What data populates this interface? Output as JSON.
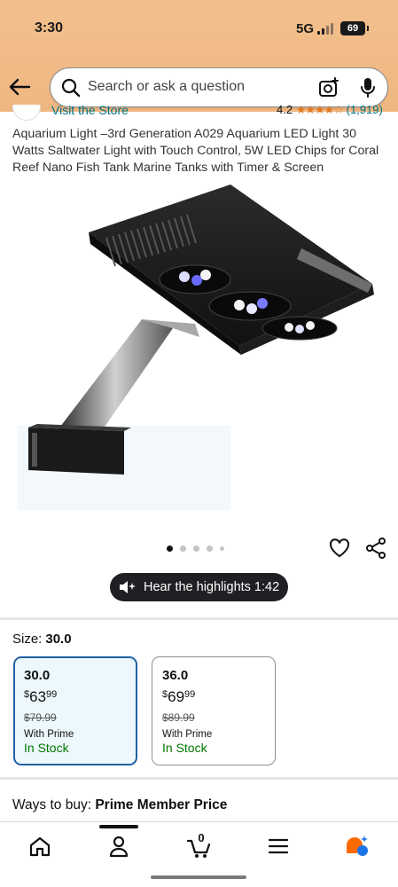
{
  "status_bar": {
    "time": "3:30",
    "network": "5G",
    "battery": "69"
  },
  "search": {
    "placeholder": "Search or ask a question"
  },
  "store": {
    "link_text": "Visit the Store",
    "rating": "4.2",
    "stars": "★★★★☆",
    "review_count": "(1,919)"
  },
  "product": {
    "title": "Aquarium Light –3rd Generation A029 Aquarium LED Light 30 Watts Saltwater Light with Touch Control, 5W LED Chips for Coral Reef Nano Fish Tank Marine Tanks with Timer & Screen",
    "image_count": 5,
    "active_image": 1
  },
  "audio": {
    "label": "Hear the highlights 1:42"
  },
  "size_section": {
    "label": "Size:",
    "selected_value": "30.0",
    "options": [
      {
        "size": "30.0",
        "currency": "$",
        "price_whole": "63",
        "price_cents": "99",
        "list_price": "$79.99",
        "prime_text": "With Prime",
        "stock": "In Stock",
        "selected": true
      },
      {
        "size": "36.0",
        "currency": "$",
        "price_whole": "69",
        "price_cents": "99",
        "list_price": "$89.99",
        "prime_text": "With Prime",
        "stock": "In Stock",
        "selected": false
      }
    ]
  },
  "ways_to_buy": {
    "label": "Ways to buy:",
    "value": "Prime Member Price"
  },
  "bottom_nav": {
    "items": [
      "home-icon",
      "account-icon",
      "cart-icon",
      "menu-icon",
      "rufus-icon"
    ],
    "cart_count": "0",
    "active_index": 1
  },
  "colors": {
    "header": "#f2c08d",
    "link": "#007185",
    "stock_green": "#007600",
    "selected_border": "#2162a1",
    "rufus_orange": "#ff6a00",
    "rufus_blue": "#1a73e8"
  }
}
